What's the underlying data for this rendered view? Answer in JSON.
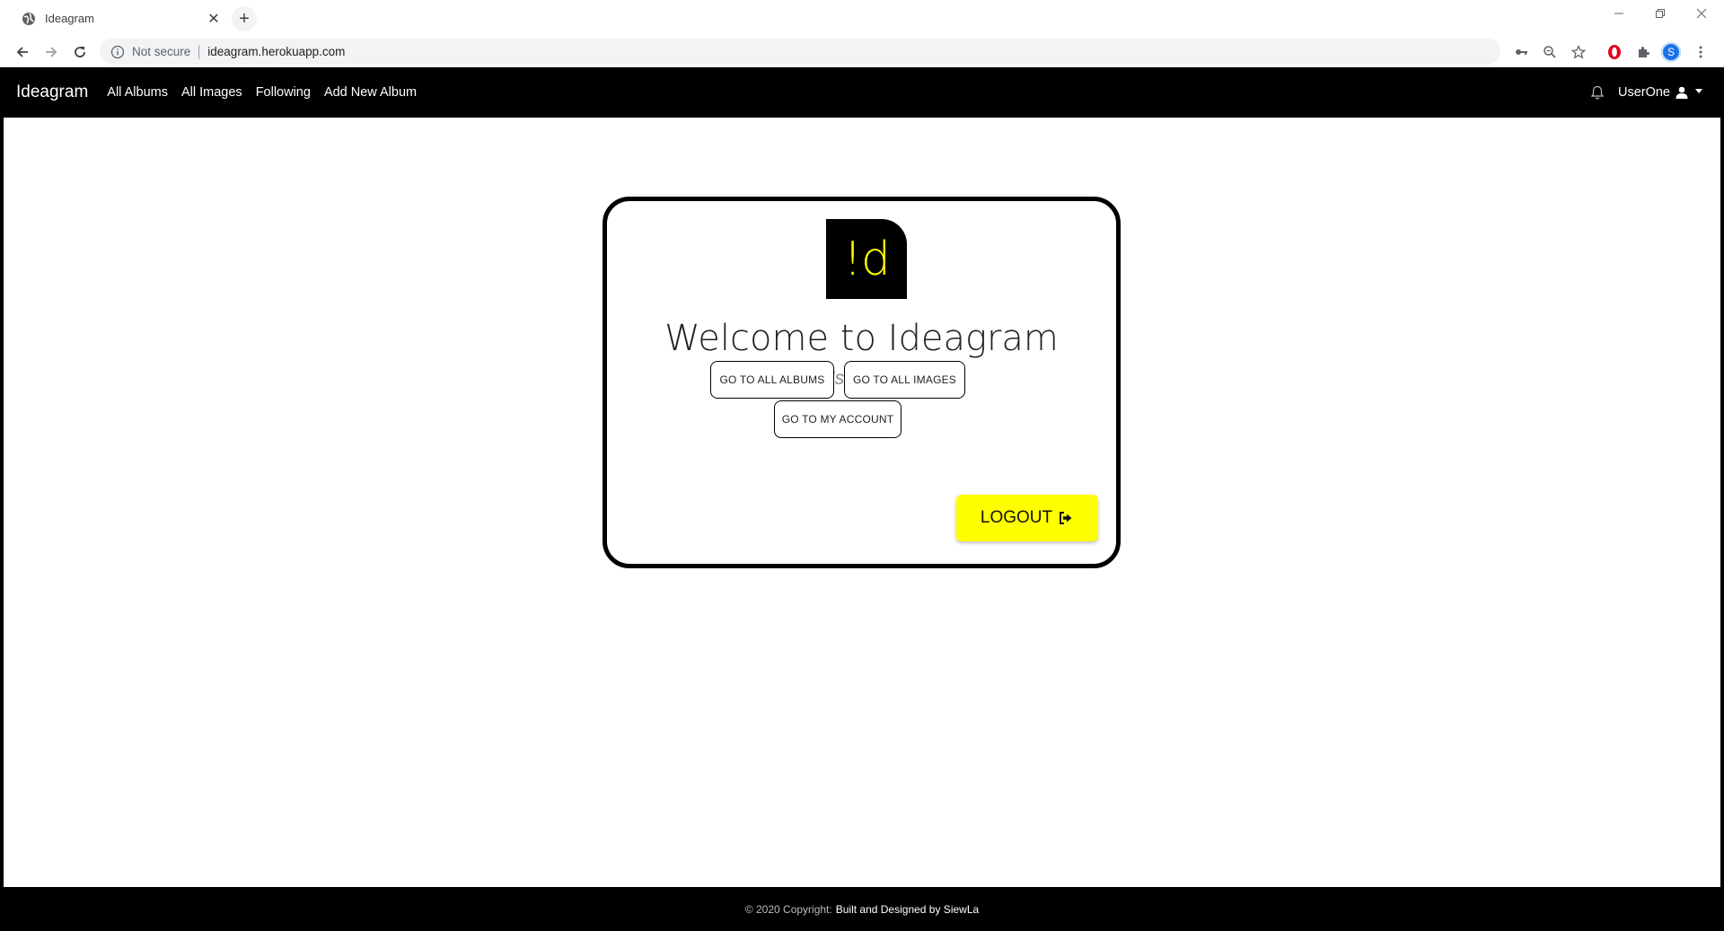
{
  "browser": {
    "tab_title": "Ideagram",
    "url_security": "Not secure",
    "url": "ideagram.herokuapp.com",
    "profile_initial": "S"
  },
  "nav": {
    "brand": "Ideagram",
    "links": [
      "All Albums",
      "All Images",
      "Following",
      "Add New Album"
    ],
    "user": "UserOne"
  },
  "welcome": {
    "logo_text": "!d",
    "title": "Welcome to Ideagram",
    "username": "UserOne!",
    "btn_albums": "GO TO ALL ALBUMS",
    "btn_images": "GO TO ALL IMAGES",
    "btn_account": "GO TO MY ACCOUNT",
    "btn_logout": "LOGOUT"
  },
  "footer": {
    "copyright": "© 2020 Copyright:",
    "credit": "Built and Designed by SiewLa"
  },
  "colors": {
    "accent": "#ffff00",
    "nav_bg": "#000000"
  }
}
